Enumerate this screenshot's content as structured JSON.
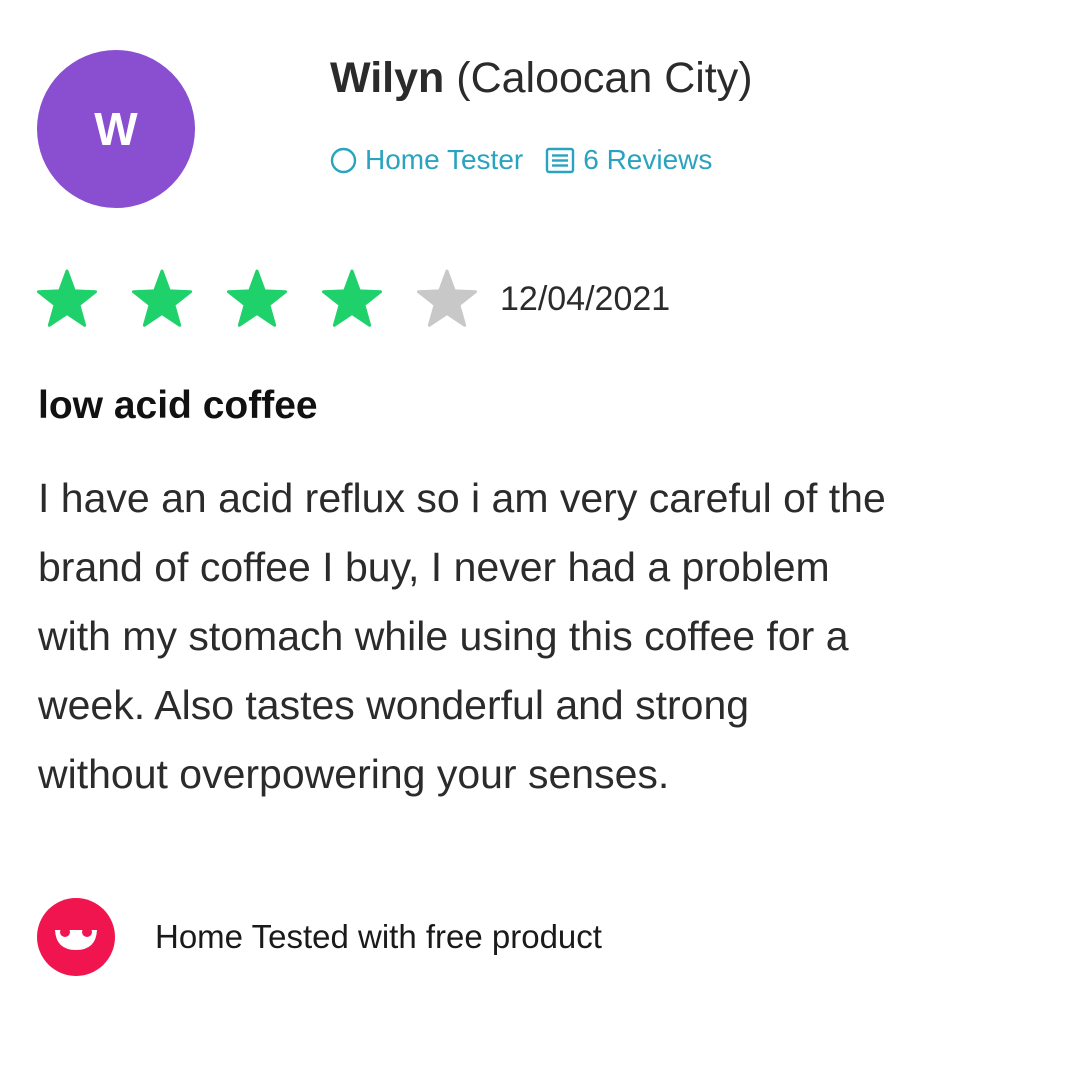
{
  "reviewer": {
    "initial": "W",
    "name": "Wilyn",
    "location": "(Caloocan City)",
    "avatar_color": "#8a4fd1",
    "role_icon": "circle-outline-icon",
    "role": "Home Tester",
    "reviews_icon": "list-icon",
    "reviews_count": "6 Reviews",
    "meta_color": "#2aa3c0"
  },
  "review": {
    "rating": 4,
    "max_rating": 5,
    "star_filled_color": "#1fd16b",
    "star_empty_color": "#c8c8c8",
    "date": "12/04/2021",
    "title": "low acid coffee",
    "body": "I have an acid reflux so i am very careful of the\nbrand of coffee I buy, I never had a problem\nwith my stomach while using this coffee for a\nweek. Also tastes wonderful and strong\nwithout overpowering your senses."
  },
  "badge": {
    "icon": "smile-logo-icon",
    "color": "#f0144f",
    "text": "Home Tested with free product"
  }
}
